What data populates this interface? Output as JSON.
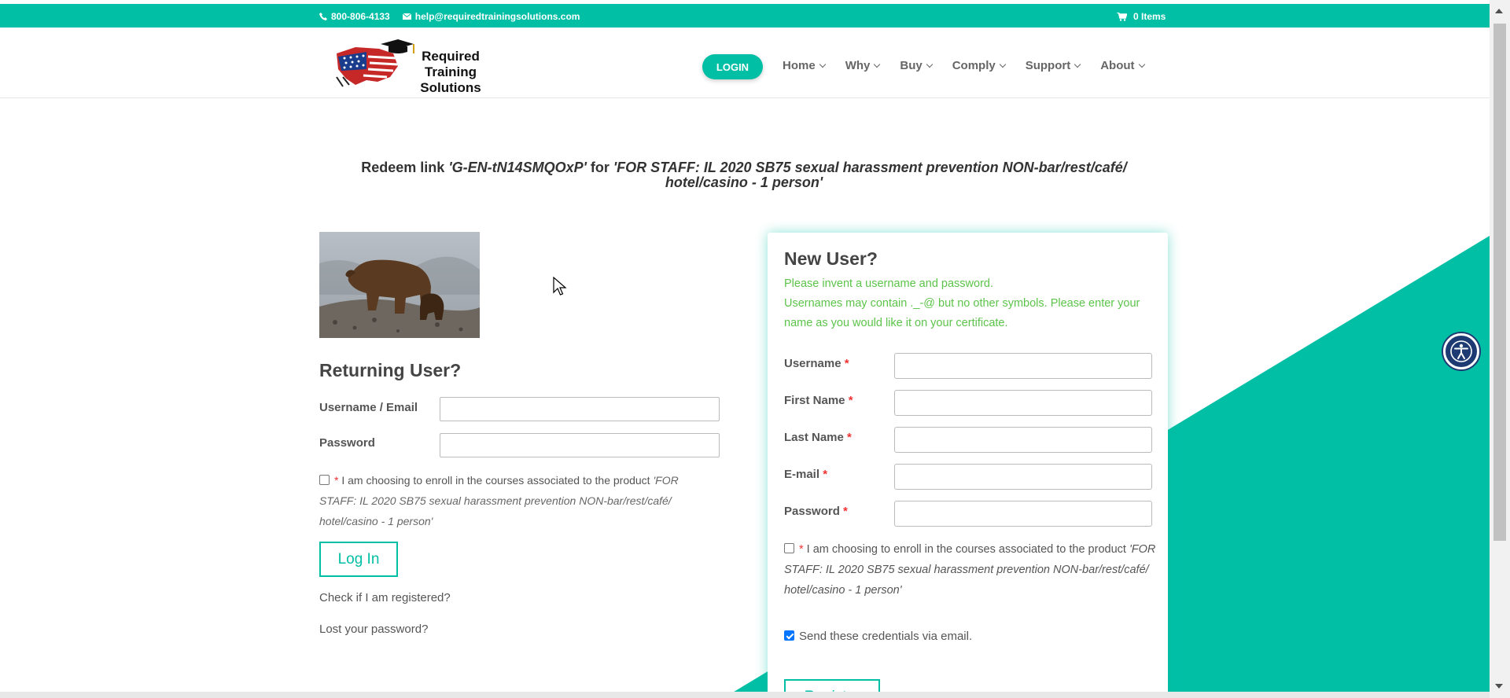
{
  "topbar": {
    "phone": "800-806-4133",
    "email": "help@requiredtrainingsolutions.com",
    "cart": "0 Items"
  },
  "header": {
    "logo_text": [
      "Required",
      "Training",
      "Solutions"
    ],
    "login_label": "LOGIN",
    "nav": [
      "Home",
      "Why",
      "Buy",
      "Comply",
      "Support",
      "About"
    ]
  },
  "heading": {
    "prefix": "Redeem link ",
    "code": "'G-EN-tN14SMQOxP'",
    "middle": " for ",
    "product": "'FOR STAFF: IL 2020 SB75 sexual harassment prevention NON-bar/rest/café/ hotel/casino - 1 person'"
  },
  "returning": {
    "title": "Returning User?",
    "username_label": "Username / Email",
    "password_label": "Password",
    "consent_text": " I am choosing to enroll in the courses associated to the product ",
    "consent_product": "'FOR STAFF: IL 2020 SB75 sexual harassment prevention NON-bar/rest/café/ hotel/casino - 1 person'",
    "login_button": "Log In",
    "check_link": "Check if I am registered?",
    "lost_link": "Lost your password?"
  },
  "new_user": {
    "title": "New User?",
    "help_line1": "Please invent a username and password.",
    "help_line2": "Usernames may contain ._-@ but no other symbols. Please enter your name as you would like it on your certificate.",
    "fields": [
      "Username",
      "First Name",
      "Last Name",
      "E-mail",
      "Password"
    ],
    "consent_text": " I am choosing to enroll in the courses associated to the product ",
    "consent_product": "'FOR STAFF: IL 2020 SB75 sexual harassment prevention NON-bar/rest/café/ hotel/casino - 1 person'",
    "send_creds": "Send these credentials via email.",
    "register_button": "Register"
  },
  "colors": {
    "brand": "#00bfa5",
    "help_text": "#5cc44a",
    "a11y": "#1d3b72"
  }
}
